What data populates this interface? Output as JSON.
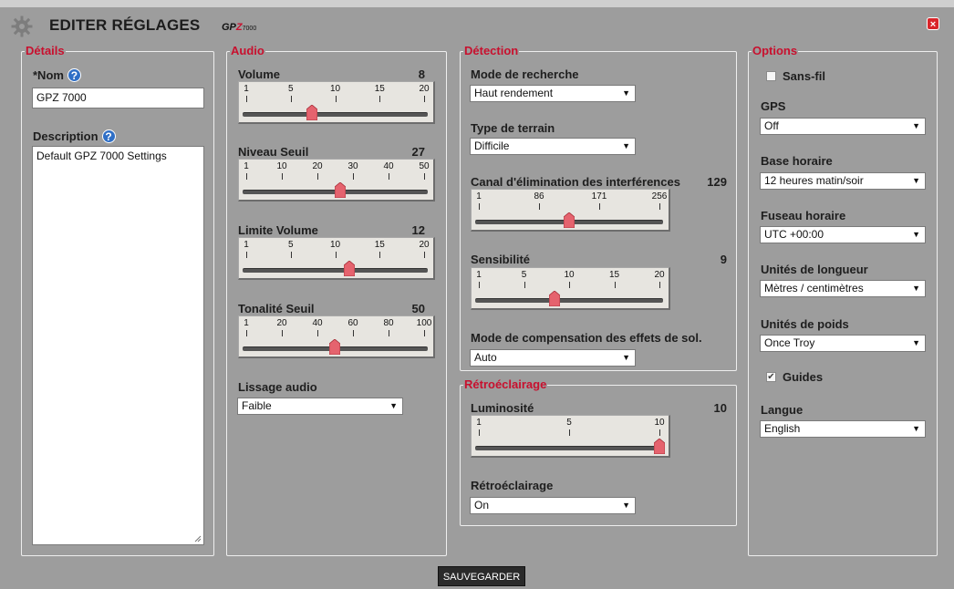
{
  "header": {
    "title": "EDITER RÉGLAGES",
    "brand_prefix": "GP",
    "brand_z": "Z",
    "brand_num": "7000",
    "close_label": "×"
  },
  "details": {
    "legend": "Détails",
    "name_label": "*Nom",
    "name_value": "GPZ 7000",
    "description_label": "Description",
    "description_value": "Default GPZ 7000 Settings",
    "help_glyph": "?"
  },
  "audio": {
    "legend": "Audio",
    "volume": {
      "label": "Volume",
      "value": "8",
      "ticks": [
        "1",
        "5",
        "10",
        "15",
        "20"
      ],
      "level": 8,
      "min": 1,
      "max": 20
    },
    "threshold_level": {
      "label": "Niveau Seuil",
      "value": "27",
      "ticks": [
        "1",
        "10",
        "20",
        "30",
        "40",
        "50"
      ],
      "level": 27,
      "min": 1,
      "max": 50
    },
    "volume_limit": {
      "label": "Limite Volume",
      "value": "12",
      "ticks": [
        "1",
        "5",
        "10",
        "15",
        "20"
      ],
      "level": 12,
      "min": 1,
      "max": 20
    },
    "threshold_tone": {
      "label": "Tonalité Seuil",
      "value": "50",
      "ticks": [
        "1",
        "20",
        "40",
        "60",
        "80",
        "100"
      ],
      "level": 50,
      "min": 1,
      "max": 100
    },
    "smoothing": {
      "label": "Lissage audio",
      "value": "Faible"
    }
  },
  "detection": {
    "legend": "Détection",
    "search_mode": {
      "label": "Mode de recherche",
      "value": "Haut rendement"
    },
    "terrain_type": {
      "label": "Type de terrain",
      "value": "Difficile"
    },
    "noise_cancel": {
      "label": "Canal d'élimination des interférences",
      "value": "129",
      "ticks": [
        "1",
        "86",
        "171",
        "256"
      ],
      "level": 129,
      "min": 1,
      "max": 256
    },
    "sensitivity": {
      "label": "Sensibilité",
      "value": "9",
      "ticks": [
        "1",
        "5",
        "10",
        "15",
        "20"
      ],
      "level": 9,
      "min": 1,
      "max": 20
    },
    "ground_balance": {
      "label": "Mode de compensation des effets de sol.",
      "value": "Auto"
    }
  },
  "backlight": {
    "legend": "Rétroéclairage",
    "brightness": {
      "label": "Luminosité",
      "value": "10",
      "ticks": [
        "1",
        "5",
        "10"
      ],
      "level": 10,
      "min": 1,
      "max": 10
    },
    "backlight": {
      "label": "Rétroéclairage",
      "value": "On"
    }
  },
  "options": {
    "legend": "Options",
    "wireless": {
      "label": "Sans-fil",
      "checked": false
    },
    "gps": {
      "label": "GPS",
      "value": "Off"
    },
    "time_base": {
      "label": "Base horaire",
      "value": "12 heures matin/soir"
    },
    "time_zone": {
      "label": "Fuseau horaire",
      "value": "UTC +00:00"
    },
    "length_units": {
      "label": "Unités de longueur",
      "value": "Mètres / centimètres"
    },
    "weight_units": {
      "label": "Unités de poids",
      "value": "Once Troy"
    },
    "guides": {
      "label": "Guides",
      "checked": true,
      "check_glyph": "✔"
    },
    "language": {
      "label": "Langue",
      "value": "English"
    }
  },
  "footer": {
    "save_label": "SAUVEGARDER"
  },
  "colors": {
    "background": "#9d9d9d",
    "legend": "#c8102e",
    "thumb": "#e5636e",
    "help": "#2f6fc6"
  },
  "icons": {
    "settings": "gear-icon",
    "close": "close-icon",
    "help": "help-icon",
    "dropdown": "dropdown-arrow-icon"
  }
}
